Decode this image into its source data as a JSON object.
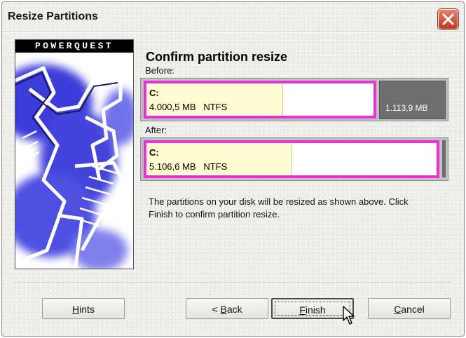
{
  "window": {
    "title": "Resize Partitions"
  },
  "logo": {
    "brand": "POWERQUEST"
  },
  "content": {
    "heading": "Confirm partition resize",
    "before_label": "Before:",
    "after_label": "After:",
    "before_partition": {
      "name": "C:",
      "size": "4.000,5 MB",
      "filesystem": "NTFS",
      "used_fraction": 0.6
    },
    "before_unallocated": "1.113,9 MB",
    "after_partition": {
      "name": "C:",
      "size": "5.106,6 MB",
      "filesystem": "NTFS",
      "used_fraction": 0.5
    },
    "description_line1": "The partitions on your disk will be resized as shown above.  Click",
    "description_line2": "Finish to confirm partition resize."
  },
  "buttons": {
    "hints": {
      "mnemonic": "H",
      "rest": "ints"
    },
    "back": {
      "prefix": "< ",
      "mnemonic": "B",
      "rest": "ack"
    },
    "finish": {
      "mnemonic": "F",
      "rest": "inish"
    },
    "cancel": {
      "mnemonic": "C",
      "rest": "ancel"
    }
  },
  "colors": {
    "partition_border": "#e831d6",
    "used_space": "#fdfcd0",
    "unallocated": "#6e6e6e",
    "close_button": "#c1391e",
    "logo_blue": "#2a2ad0"
  },
  "icons": {
    "close": "close-icon",
    "cursor": "arrow-cursor-icon"
  }
}
